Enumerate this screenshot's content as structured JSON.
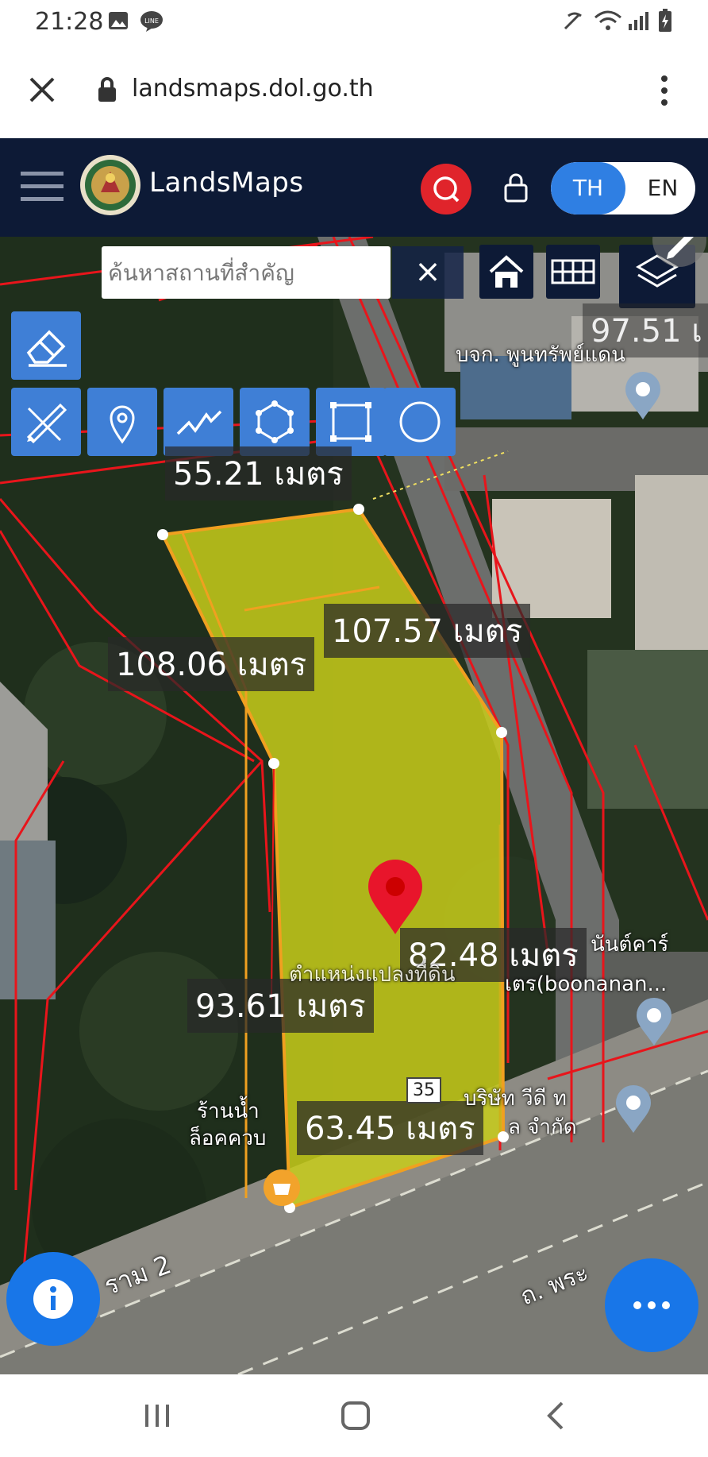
{
  "status_bar": {
    "time": "21:28"
  },
  "browser": {
    "url": "landsmaps.dol.go.th"
  },
  "header": {
    "brand": "LandsMaps",
    "lang_th": "TH",
    "lang_en": "EN"
  },
  "search": {
    "placeholder": "ค้นหาสถานที่สำคัญ"
  },
  "measurements": {
    "m1": "55.21 เมตร",
    "m2": "107.57 เมตร",
    "m3": "108.06 เมตร",
    "m4": "82.48 เมตร",
    "m5": "93.61 เมตร",
    "m6": "63.45 เมตร",
    "m7": "97.51 เ"
  },
  "map_labels": {
    "poi1": "บจก. พูนทรัพย์แดน",
    "poi2": "นันต์คาร์",
    "poi3": "เตร(boonanan...",
    "poi4": "ตำแหน่งแปลงที่ดิน",
    "poi5": "บริษัท วีดี ท",
    "poi6": "ล จำกัด",
    "poi7": "ร้านน้ำ",
    "poi8": "ล็อคควบ",
    "road1": "ราม 2",
    "road2": "ถ. พระ",
    "road_number": "35"
  },
  "colors": {
    "header_bg": "#0d1a36",
    "accent_blue": "#2f7fe3",
    "search_red": "#e0242b",
    "parcel_fill": "#c8cc1a",
    "parcel_edge": "#f0a020",
    "boundary_red": "#e8151b",
    "tool_blue": "#3f7fd6",
    "fab_blue": "#1876e8"
  }
}
